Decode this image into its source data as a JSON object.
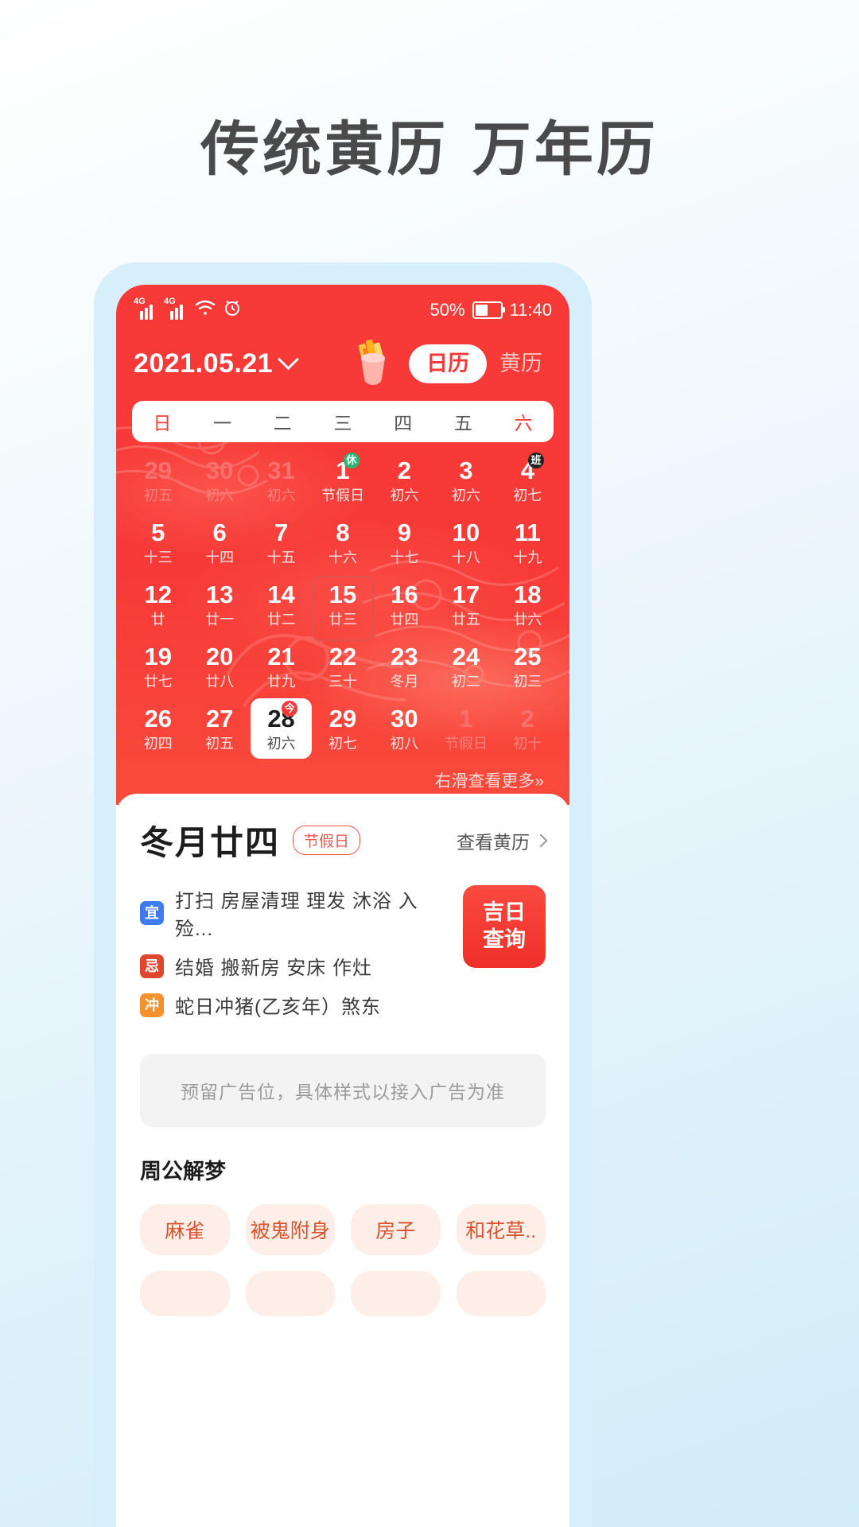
{
  "promo": {
    "headline": "传统黄历 万年历"
  },
  "status_bar": {
    "network_1": "4G",
    "network_2": "4G",
    "wifi_icon": "wifi-icon",
    "alarm_icon": "alarm-icon",
    "battery_percent": "50%",
    "time": "11:40"
  },
  "header": {
    "date": "2021.05.21",
    "chevron_icon": "chevron-down-icon",
    "fortune_icon": "fortune-sticks-icon",
    "tab_calendar": "日历",
    "tab_almanac": "黄历"
  },
  "weekdays": [
    "日",
    "一",
    "二",
    "三",
    "四",
    "五",
    "六"
  ],
  "calendar": {
    "swipe_hint": "右滑查看更多»",
    "days": [
      {
        "num": "29",
        "lunar": "初五",
        "dim": true
      },
      {
        "num": "30",
        "lunar": "初六",
        "dim": true
      },
      {
        "num": "31",
        "lunar": "初六",
        "dim": true
      },
      {
        "num": "1",
        "lunar": "节假日",
        "badge": "休",
        "badge_type": "rest"
      },
      {
        "num": "2",
        "lunar": "初六"
      },
      {
        "num": "3",
        "lunar": "初六"
      },
      {
        "num": "4",
        "lunar": "初七",
        "badge": "班",
        "badge_type": "work"
      },
      {
        "num": "5",
        "lunar": "十三"
      },
      {
        "num": "6",
        "lunar": "十四"
      },
      {
        "num": "7",
        "lunar": "十五"
      },
      {
        "num": "8",
        "lunar": "十六"
      },
      {
        "num": "9",
        "lunar": "十七"
      },
      {
        "num": "10",
        "lunar": "十八"
      },
      {
        "num": "11",
        "lunar": "十九"
      },
      {
        "num": "12",
        "lunar": "廿"
      },
      {
        "num": "13",
        "lunar": "廿一"
      },
      {
        "num": "14",
        "lunar": "廿二"
      },
      {
        "num": "15",
        "lunar": "廿三",
        "outline": true
      },
      {
        "num": "16",
        "lunar": "廿四"
      },
      {
        "num": "17",
        "lunar": "廿五"
      },
      {
        "num": "18",
        "lunar": "廿六"
      },
      {
        "num": "19",
        "lunar": "廿七"
      },
      {
        "num": "20",
        "lunar": "廿八"
      },
      {
        "num": "21",
        "lunar": "廿九"
      },
      {
        "num": "22",
        "lunar": "三十"
      },
      {
        "num": "23",
        "lunar": "冬月"
      },
      {
        "num": "24",
        "lunar": "初二"
      },
      {
        "num": "25",
        "lunar": "初三"
      },
      {
        "num": "26",
        "lunar": "初四"
      },
      {
        "num": "27",
        "lunar": "初五"
      },
      {
        "num": "28",
        "lunar": "初六",
        "selected": true,
        "badge": "今",
        "badge_type": "today"
      },
      {
        "num": "29",
        "lunar": "初七"
      },
      {
        "num": "30",
        "lunar": "初八"
      },
      {
        "num": "1",
        "lunar": "节假日",
        "dim": true
      },
      {
        "num": "2",
        "lunar": "初十",
        "dim": true
      }
    ]
  },
  "detail": {
    "lunar_title": "冬月廿四",
    "holiday_tag": "节假日",
    "view_almanac": "查看黄历",
    "rows": [
      {
        "label": "宜",
        "type": "yi",
        "text": "打扫  房屋清理  理发  沐浴  入殓..."
      },
      {
        "label": "忌",
        "type": "ji",
        "text": "结婚  搬新房  安床  作灶"
      },
      {
        "label": "冲",
        "type": "chong",
        "text": "蛇日冲猪(乙亥年）煞东"
      }
    ],
    "lucky_button_line1": "吉日",
    "lucky_button_line2": "查询"
  },
  "ad": {
    "placeholder": "预留广告位，具体样式以接入广告为准"
  },
  "dream": {
    "section_title": "周公解梦",
    "tags": [
      "麻雀",
      "被鬼附身",
      "房子",
      "和花草.."
    ],
    "tags_row2": [
      "",
      "",
      "",
      ""
    ]
  },
  "colors": {
    "brand_red": "#f73a38",
    "accent_orange": "#d9542e",
    "rest_green": "#2bb673",
    "yi_blue": "#3e7bf0",
    "ji_red": "#e0462f",
    "chong_orange": "#f5922b"
  }
}
